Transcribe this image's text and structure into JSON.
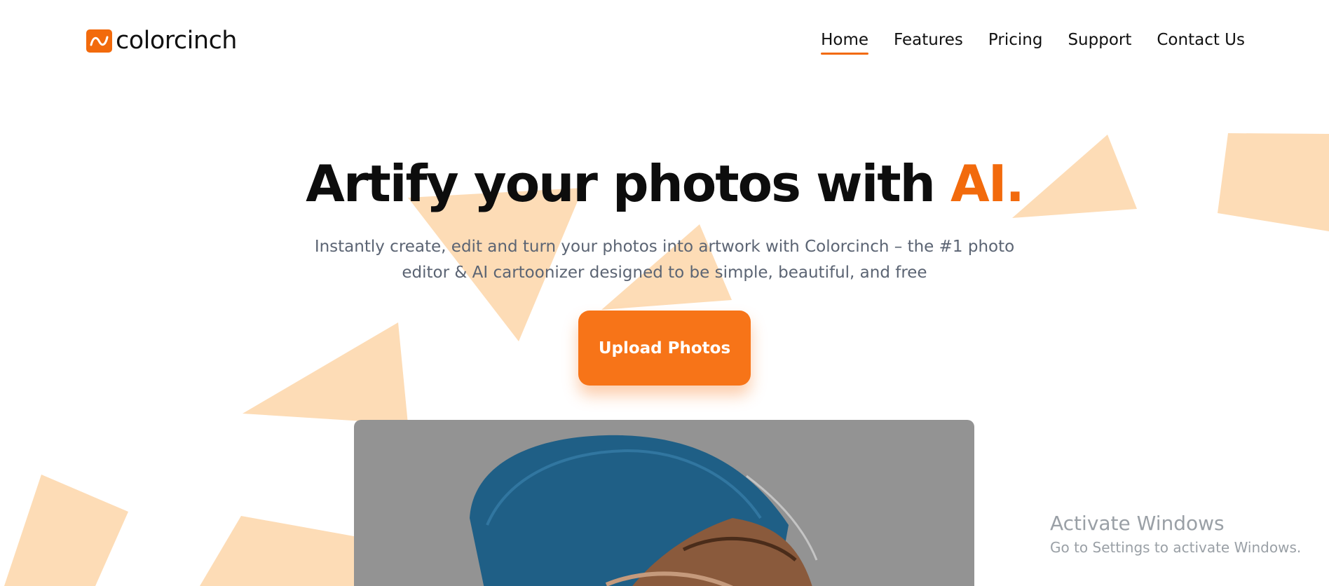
{
  "brand": {
    "name": "colorcinch",
    "logo_icon": "wave-icon",
    "accent_color": "#f26a0c"
  },
  "nav": {
    "items": [
      {
        "label": "Home",
        "active": true
      },
      {
        "label": "Features",
        "active": false
      },
      {
        "label": "Pricing",
        "active": false
      },
      {
        "label": "Support",
        "active": false
      },
      {
        "label": "Contact Us",
        "active": false
      }
    ]
  },
  "hero": {
    "title_main": "Artify your photos with ",
    "title_accent": "AI.",
    "subtitle_line1": "Instantly create, edit and turn your photos into artwork with Colorcinch – the #1 photo",
    "subtitle_line2": "editor & AI cartoonizer designed to be simple, beautiful, and free",
    "cta_label": "Upload Photos",
    "cta_color": "#f77418"
  },
  "decor": {
    "shape_color": "#fddcb6"
  },
  "watermark": {
    "title": "Activate Windows",
    "subtitle": "Go to Settings to activate Windows."
  }
}
